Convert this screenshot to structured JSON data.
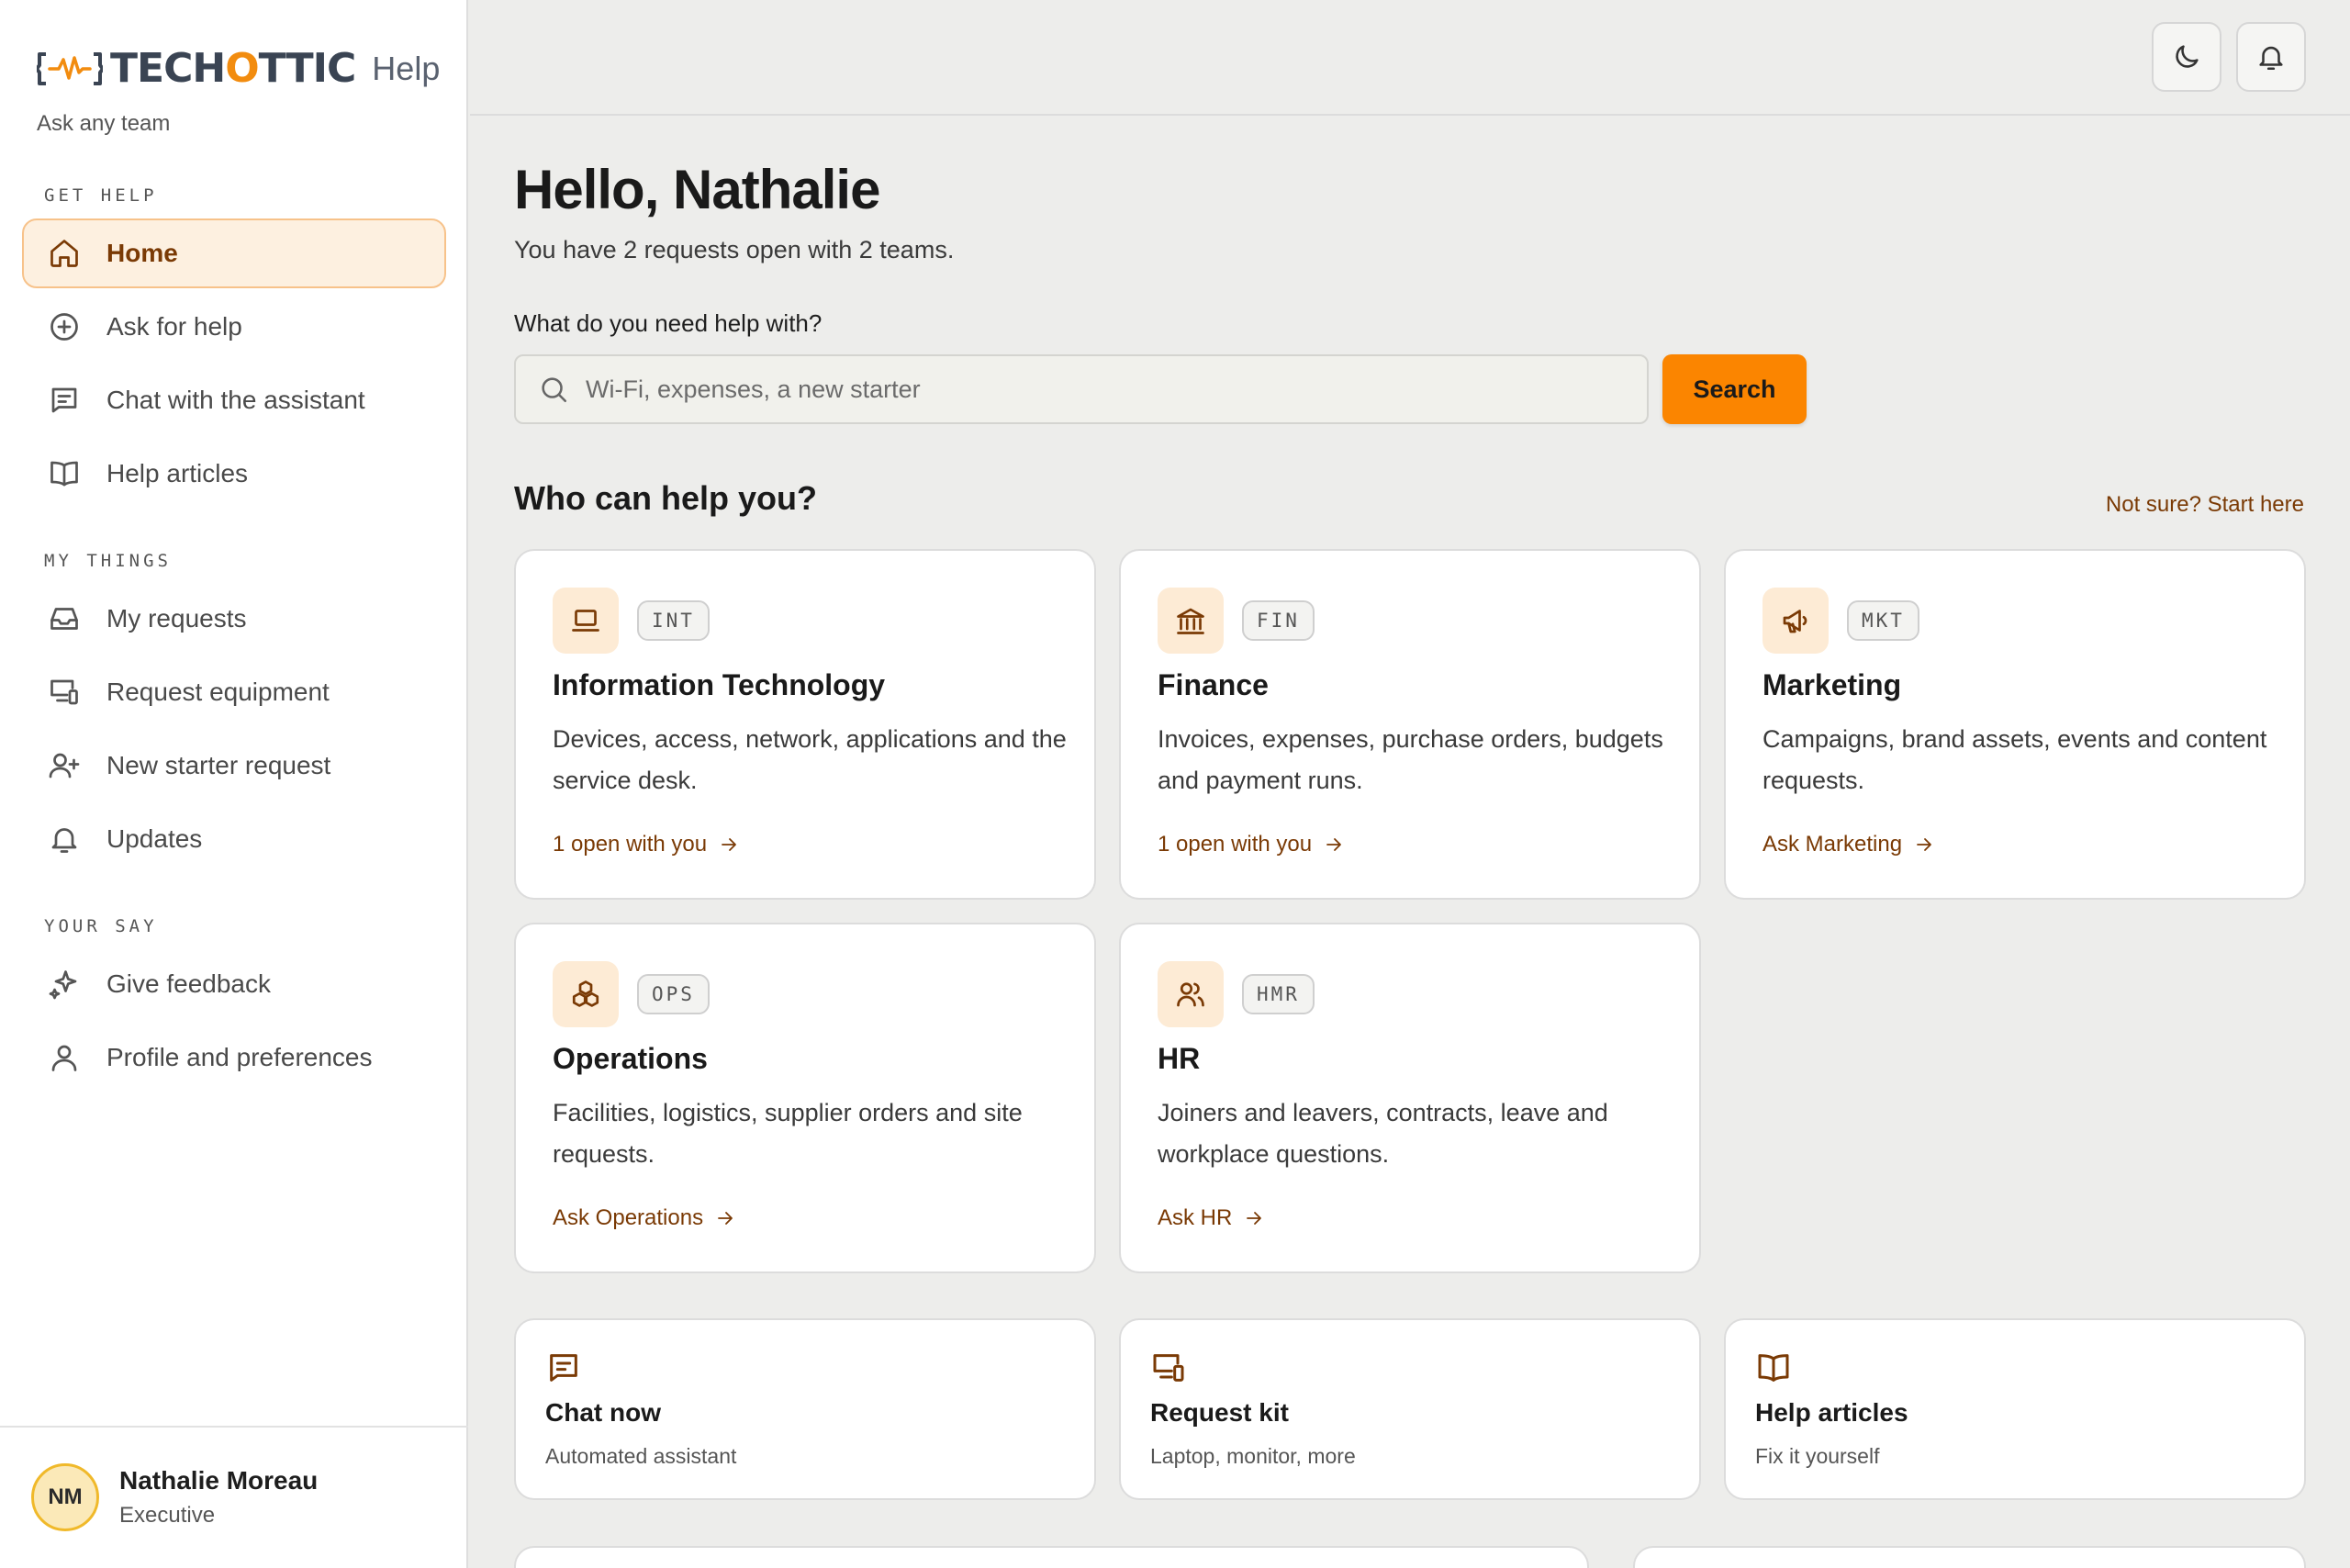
{
  "app": {
    "brand_pre": "TECH",
    "brand_o": "O",
    "brand_post": "TTIC",
    "help_word": "Help",
    "tagline": "Ask any team",
    "accent": "#fb8500",
    "brand_dark": "#7a3a05"
  },
  "sidebar": {
    "sections": [
      {
        "label": "GET HELP",
        "items": [
          {
            "label": "Home",
            "icon": "home-icon",
            "active": true
          },
          {
            "label": "Ask for help",
            "icon": "plus-circle-icon"
          },
          {
            "label": "Chat with the assistant",
            "icon": "chat-icon"
          },
          {
            "label": "Help articles",
            "icon": "book-icon"
          }
        ]
      },
      {
        "label": "MY THINGS",
        "items": [
          {
            "label": "My requests",
            "icon": "inbox-icon"
          },
          {
            "label": "Request equipment",
            "icon": "devices-icon"
          },
          {
            "label": "New starter request",
            "icon": "user-plus-icon"
          },
          {
            "label": "Updates",
            "icon": "bell-icon"
          }
        ]
      },
      {
        "label": "YOUR SAY",
        "items": [
          {
            "label": "Give feedback",
            "icon": "sparkle-icon"
          },
          {
            "label": "Profile and preferences",
            "icon": "user-icon"
          }
        ]
      }
    ],
    "user": {
      "initials": "NM",
      "name": "Nathalie Moreau",
      "role": "Executive"
    }
  },
  "topbar": {
    "icons": [
      "moon-icon",
      "bell-icon"
    ]
  },
  "main": {
    "greeting": "Hello, Nathalie",
    "subtitle": "You have 2 requests open with 2 teams.",
    "search": {
      "label": "What do you need help with?",
      "placeholder": "Wi-Fi, expenses, a new starter",
      "button": "Search"
    },
    "who_title": "Who can help you?",
    "not_sure": "Not sure? Start here",
    "teams": [
      {
        "code": "INT",
        "name": "Information Technology",
        "desc": "Devices, access, network, applications and the service desk.",
        "link": "1 open with you",
        "icon": "laptop-icon"
      },
      {
        "code": "FIN",
        "name": "Finance",
        "desc": "Invoices, expenses, purchase orders, budgets and payment runs.",
        "link": "1 open with you",
        "icon": "bank-icon"
      },
      {
        "code": "MKT",
        "name": "Marketing",
        "desc": "Campaigns, brand assets, events and content requests.",
        "link": "Ask Marketing",
        "icon": "megaphone-icon"
      },
      {
        "code": "OPS",
        "name": "Operations",
        "desc": "Facilities, logistics, supplier orders and site requests.",
        "link": "Ask Operations",
        "icon": "boxes-icon"
      },
      {
        "code": "HMR",
        "name": "HR",
        "desc": "Joiners and leavers, contracts, leave and workplace questions.",
        "link": "Ask HR",
        "icon": "users-icon"
      }
    ],
    "quick": [
      {
        "title": "Chat now",
        "sub": "Automated assistant",
        "icon": "chat-icon"
      },
      {
        "title": "Request kit",
        "sub": "Laptop, monitor, more",
        "icon": "devices-icon"
      },
      {
        "title": "Help articles",
        "sub": "Fix it yourself",
        "icon": "book-icon"
      }
    ]
  }
}
